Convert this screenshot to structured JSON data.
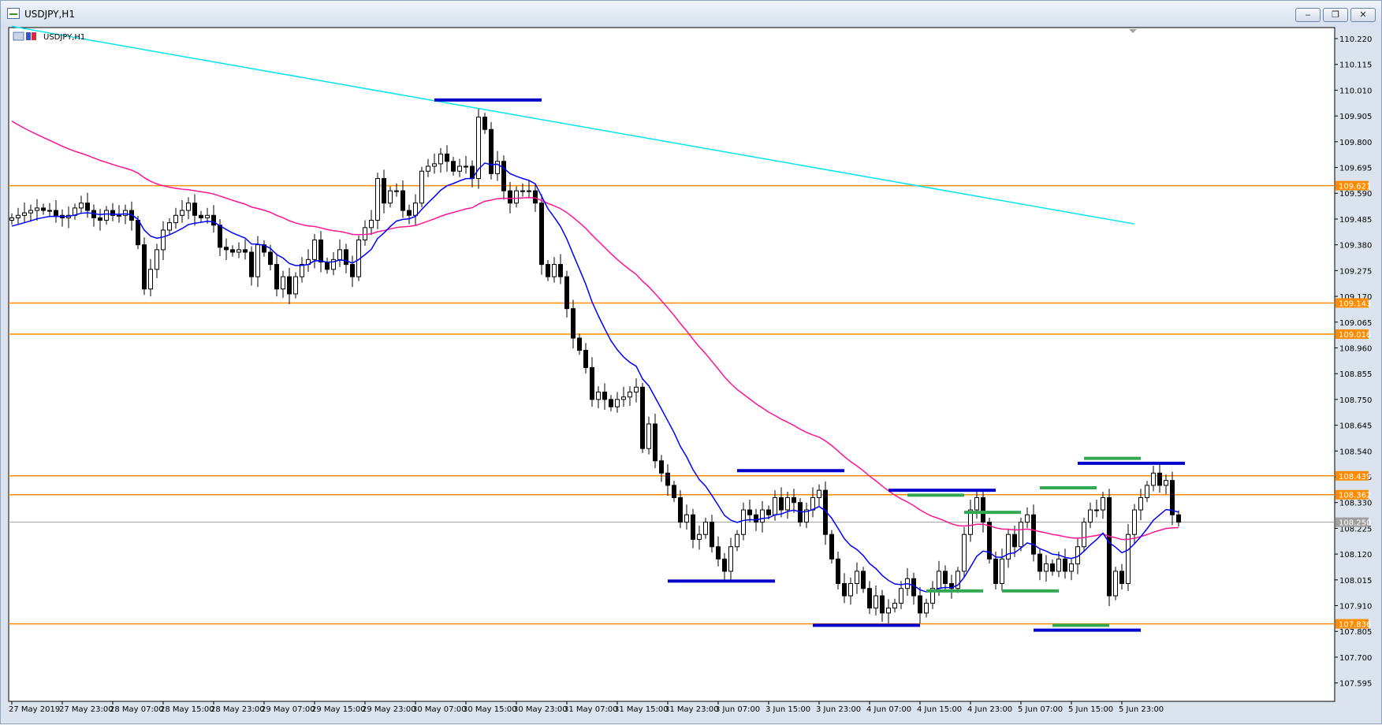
{
  "window": {
    "title": "USDJPY,H1",
    "minimize_glyph": "‒",
    "restore_glyph": "❐",
    "close_glyph": "✕"
  },
  "chart_header": "USDJPY,H1",
  "colors": {
    "bull_body": "#ffffff",
    "bear_body": "#000000",
    "ma_slow": "#00e5ee",
    "ma_mid": "#ff1493",
    "ma_fast": "#0000ff",
    "level": "#ff8c00",
    "resistance_marker": "#0000cd",
    "support_marker": "#32a852",
    "current_price": "#a0a0a0"
  },
  "chart_data": {
    "type": "candlestick",
    "symbol": "USDJPY",
    "timeframe": "H1",
    "ylim": [
      107.52,
      110.265
    ],
    "y_ticks": [
      110.22,
      110.115,
      110.01,
      109.905,
      109.8,
      109.695,
      109.59,
      109.485,
      109.38,
      109.275,
      109.17,
      109.065,
      108.96,
      108.855,
      108.75,
      108.645,
      108.54,
      108.435,
      108.33,
      108.225,
      108.12,
      108.015,
      107.91,
      107.805,
      107.7,
      107.595
    ],
    "x_labels": [
      {
        "i": 0,
        "label": "27 May 2019"
      },
      {
        "i": 8,
        "label": "27 May 23:00"
      },
      {
        "i": 16,
        "label": "28 May 07:00"
      },
      {
        "i": 24,
        "label": "28 May 15:00"
      },
      {
        "i": 32,
        "label": "28 May 23:00"
      },
      {
        "i": 40,
        "label": "29 May 07:00"
      },
      {
        "i": 48,
        "label": "29 May 15:00"
      },
      {
        "i": 56,
        "label": "29 May 23:00"
      },
      {
        "i": 64,
        "label": "30 May 07:00"
      },
      {
        "i": 72,
        "label": "30 May 15:00"
      },
      {
        "i": 80,
        "label": "30 May 23:00"
      },
      {
        "i": 88,
        "label": "31 May 07:00"
      },
      {
        "i": 96,
        "label": "31 May 15:00"
      },
      {
        "i": 104,
        "label": "31 May 23:00"
      },
      {
        "i": 112,
        "label": "3 Jun 07:00"
      },
      {
        "i": 120,
        "label": "3 Jun 15:00"
      },
      {
        "i": 128,
        "label": "3 Jun 23:00"
      },
      {
        "i": 136,
        "label": "4 Jun 07:00"
      },
      {
        "i": 144,
        "label": "4 Jun 15:00"
      },
      {
        "i": 152,
        "label": "4 Jun 23:00"
      },
      {
        "i": 160,
        "label": "5 Jun 07:00"
      },
      {
        "i": 168,
        "label": "5 Jun 15:00"
      },
      {
        "i": 176,
        "label": "5 Jun 23:00"
      }
    ],
    "closes": [
      109.49,
      109.5,
      109.51,
      109.52,
      109.53,
      109.52,
      109.52,
      109.5,
      109.49,
      109.5,
      109.53,
      109.55,
      109.52,
      109.49,
      109.48,
      109.52,
      109.5,
      109.5,
      109.52,
      109.48,
      109.38,
      109.2,
      109.28,
      109.36,
      109.44,
      109.47,
      109.5,
      109.52,
      109.55,
      109.5,
      109.49,
      109.5,
      109.46,
      109.37,
      109.36,
      109.35,
      109.36,
      109.35,
      109.25,
      109.38,
      109.35,
      109.3,
      109.2,
      109.25,
      109.18,
      109.25,
      109.3,
      109.32,
      109.4,
      109.31,
      109.28,
      109.32,
      109.36,
      109.3,
      109.25,
      109.4,
      109.45,
      109.48,
      109.65,
      109.55,
      109.6,
      109.6,
      109.52,
      109.5,
      109.55,
      109.68,
      109.7,
      109.71,
      109.75,
      109.72,
      109.68,
      109.7,
      109.7,
      109.65,
      109.9,
      109.85,
      109.67,
      109.72,
      109.6,
      109.55,
      109.6,
      109.6,
      109.6,
      109.55,
      109.3,
      109.25,
      109.3,
      109.25,
      109.12,
      109.0,
      108.95,
      108.88,
      108.75,
      108.78,
      108.75,
      108.72,
      108.75,
      108.76,
      108.78,
      108.8,
      108.55,
      108.65,
      108.5,
      108.45,
      108.4,
      108.35,
      108.25,
      108.28,
      108.18,
      108.2,
      108.25,
      108.15,
      108.1,
      108.05,
      108.15,
      108.2,
      108.3,
      108.28,
      108.25,
      108.3,
      108.28,
      108.35,
      108.3,
      108.35,
      108.33,
      108.25,
      108.3,
      108.35,
      108.38,
      108.2,
      108.1,
      108.0,
      107.95,
      108.0,
      108.05,
      107.98,
      107.9,
      107.95,
      107.88,
      107.9,
      107.92,
      107.98,
      108.02,
      107.95,
      107.88,
      107.92,
      107.98,
      108.05,
      108.0,
      107.98,
      108.05,
      108.2,
      108.3,
      108.35,
      108.25,
      108.1,
      108.0,
      108.1,
      108.2,
      108.15,
      108.25,
      108.28,
      108.12,
      108.05,
      108.08,
      108.05,
      108.1,
      108.05,
      108.08,
      108.15,
      108.25,
      108.3,
      108.3,
      108.35,
      107.95,
      108.05,
      108.0,
      108.2,
      108.3,
      108.35,
      108.4,
      108.45,
      108.4,
      108.42,
      108.28,
      108.25
    ],
    "ma_slow": {
      "name": "",
      "start": [
        110.27,
        0
      ],
      "end": [
        109.465,
        178
      ]
    },
    "levels": [
      109.621,
      109.143,
      109.016,
      108.439,
      108.362,
      107.836
    ],
    "current_price": 108.25,
    "markers": {
      "resistance": [
        {
          "y": 109.97,
          "i0": 67,
          "i1": 84
        },
        {
          "y": 108.46,
          "i0": 115,
          "i1": 132
        },
        {
          "y": 108.38,
          "i0": 139,
          "i1": 156
        },
        {
          "y": 108.49,
          "i0": 169,
          "i1": 186
        }
      ],
      "support": [
        {
          "y": 108.01,
          "i0": 104,
          "i1": 121
        },
        {
          "y": 107.83,
          "i0": 127,
          "i1": 144
        },
        {
          "y": 107.81,
          "i0": 162,
          "i1": 179
        }
      ],
      "green_tops": [
        {
          "y": 108.36,
          "i0": 142,
          "i1": 151
        },
        {
          "y": 108.29,
          "i0": 151,
          "i1": 160
        },
        {
          "y": 108.39,
          "i0": 163,
          "i1": 172
        },
        {
          "y": 108.51,
          "i0": 170,
          "i1": 179
        }
      ],
      "green_bottoms": [
        {
          "y": 107.97,
          "i0": 145,
          "i1": 154
        },
        {
          "y": 107.97,
          "i0": 157,
          "i1": 166
        },
        {
          "y": 107.83,
          "i0": 165,
          "i1": 174
        }
      ]
    }
  }
}
